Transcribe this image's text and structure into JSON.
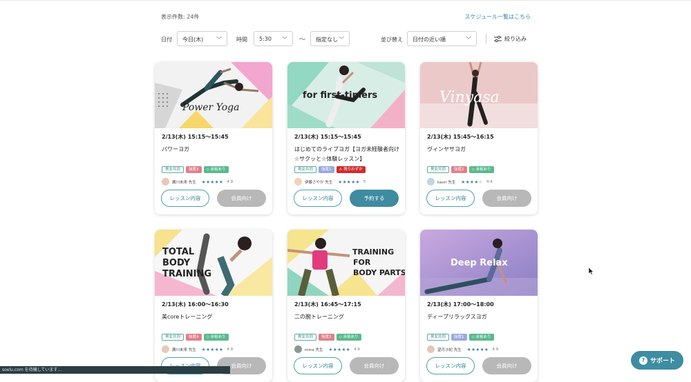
{
  "header": {
    "count_label": "表示件数: 24件",
    "schedule_link": "スケジュール一覧はこちら"
  },
  "filters": {
    "date_label": "日付",
    "date_value": "今日(木)",
    "time_label": "時間",
    "time_start": "5:30",
    "tilde": "〜",
    "time_end": "指定なし",
    "sort_label": "並び替え",
    "sort_value": "日付の近い順",
    "filter_label": "絞り込み"
  },
  "cards": [
    {
      "time": "2/13(木) 15:15〜15:45",
      "title": "パワーヨガ",
      "banner_text": "Power Yoga",
      "badges": [
        {
          "t": "男女共同",
          "c": "out"
        },
        {
          "t": "強度3",
          "c": "red"
        },
        {
          "t": "◇ 余裕あり",
          "c": "green"
        }
      ],
      "teacher": "廣川未来 先生",
      "stars": "★★★★★",
      "rating": "4.9",
      "btn1": "レッスン内容",
      "btn2": "会員向け",
      "btn2_style": "gray"
    },
    {
      "time": "2/13(木) 15:15〜15:45",
      "title": "はじめてのライブヨガ【ヨガ未経験者向け☆サクッと☆体験レッスン】",
      "banner_text": "for first-timers",
      "badges": [
        {
          "t": "男女共同",
          "c": "out"
        },
        {
          "t": "強度1",
          "c": "blue"
        },
        {
          "t": "⚠ 残りわずか",
          "c": "alert"
        }
      ],
      "teacher": "伊藤さやか 先生",
      "stars": "★★★★★",
      "rating": "5",
      "btn1": "レッスン内容",
      "btn2": "予約する",
      "btn2_style": "teal"
    },
    {
      "time": "2/13(木) 15:45〜16:15",
      "title": "ヴィンヤサヨガ",
      "banner_text": "Vinyasa",
      "badges": [
        {
          "t": "男女共同",
          "c": "out"
        },
        {
          "t": "強度2",
          "c": "red"
        },
        {
          "t": "◇ 余裕あり",
          "c": "green"
        }
      ],
      "teacher": "kaori 先生",
      "stars": "★★★★☆",
      "rating": "4.4",
      "btn1": "レッスン内容",
      "btn2": "会員向け",
      "btn2_style": "gray"
    },
    {
      "time": "2/13(木) 16:00〜16:30",
      "title": "美coreトレーニング",
      "banner_text": "TOTAL BODY TRAINING",
      "badges": [
        {
          "t": "男女共同",
          "c": "out"
        },
        {
          "t": "強度4",
          "c": "red"
        },
        {
          "t": "◇ 余裕あり",
          "c": "green"
        }
      ],
      "teacher": "廣川未来 先生",
      "stars": "★★★★★",
      "rating": "4.9",
      "btn1": "レッスン内容",
      "btn2": "会員向け",
      "btn2_style": "gray"
    },
    {
      "time": "2/13(木) 16:45〜17:15",
      "title": "二の腕トレーニング",
      "banner_text": "TRAINING FOR BODY PARTS",
      "badges": [
        {
          "t": "男女共同",
          "c": "out"
        },
        {
          "t": "強度2",
          "c": "red"
        },
        {
          "t": "◇ 余裕あり",
          "c": "green"
        }
      ],
      "teacher": "mina 先生",
      "stars": "★★★★★",
      "rating": "4.9",
      "btn1": "レッスン内容",
      "btn2": "会員向け",
      "btn2_style": "gray"
    },
    {
      "time": "2/13(木) 17:00〜18:00",
      "title": "ディープリラックスヨガ",
      "banner_text": "Deep Relax",
      "badges": [
        {
          "t": "男女共同",
          "c": "out"
        },
        {
          "t": "強度1",
          "c": "blue"
        },
        {
          "t": "◇ 余裕あり",
          "c": "green"
        }
      ],
      "teacher": "望月沙紀 先生",
      "stars": "★★★★★",
      "rating": "4.9",
      "btn1": "レッスン内容",
      "btn2": "会員向け",
      "btn2_style": "gray"
    }
  ],
  "support_label": "サポート",
  "support_icon": "?",
  "status_text": "soelu.com を待機しています..."
}
